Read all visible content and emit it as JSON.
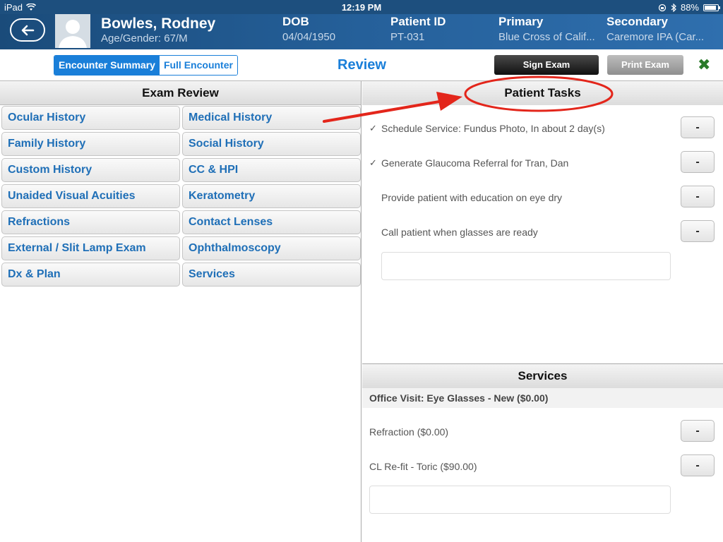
{
  "status_bar": {
    "device": "iPad",
    "time": "12:19 PM",
    "battery": "88%",
    "battery_level": 0.88
  },
  "header": {
    "patient_name": "Bowles, Rodney",
    "age_gender": "Age/Gender: 67/M",
    "dob_label": "DOB",
    "dob_value": "04/04/1950",
    "pid_label": "Patient ID",
    "pid_value": "PT-031",
    "primary_label": "Primary",
    "primary_value": "Blue Cross of Calif...",
    "secondary_label": "Secondary",
    "secondary_value": "Caremore IPA (Car..."
  },
  "toolbar": {
    "tab_summary": "Encounter Summary",
    "tab_full": "Full Encounter",
    "title": "Review",
    "sign_label": "Sign Exam",
    "print_label": "Print Exam",
    "close_glyph": "✖"
  },
  "exam_review": {
    "title": "Exam Review",
    "items": [
      "Ocular History",
      "Medical History",
      "Family History",
      "Social History",
      "Custom History",
      "CC & HPI",
      "Unaided Visual Acuities",
      "Keratometry",
      "Refractions",
      "Contact Lenses",
      "External / Slit Lamp Exam",
      "Ophthalmoscopy",
      "Dx & Plan",
      "Services"
    ]
  },
  "patient_tasks": {
    "title": "Patient Tasks",
    "tasks": [
      {
        "text": "Schedule Service: Fundus Photo, In about 2 day(s)",
        "check": "✓"
      },
      {
        "text": "Generate Glaucoma Referral for Tran, Dan",
        "check": "✓"
      },
      {
        "text": "Provide patient with education on eye dry",
        "check": ""
      },
      {
        "text": "Call patient when glasses are ready",
        "check": ""
      }
    ],
    "remove_label": "-"
  },
  "services": {
    "title": "Services",
    "visit": "Office Visit: Eye Glasses - New ($0.00)",
    "items": [
      {
        "text": "Refraction ($0.00)"
      },
      {
        "text": "CL Re-fit - Toric ($90.00)"
      }
    ],
    "remove_label": "-"
  },
  "colors": {
    "header_blue": "#1d4f7e",
    "accent_blue": "#1a7fd9",
    "link_blue": "#1f6fb7",
    "annotation_red": "#e3261b",
    "close_green": "#2a7a2a"
  }
}
